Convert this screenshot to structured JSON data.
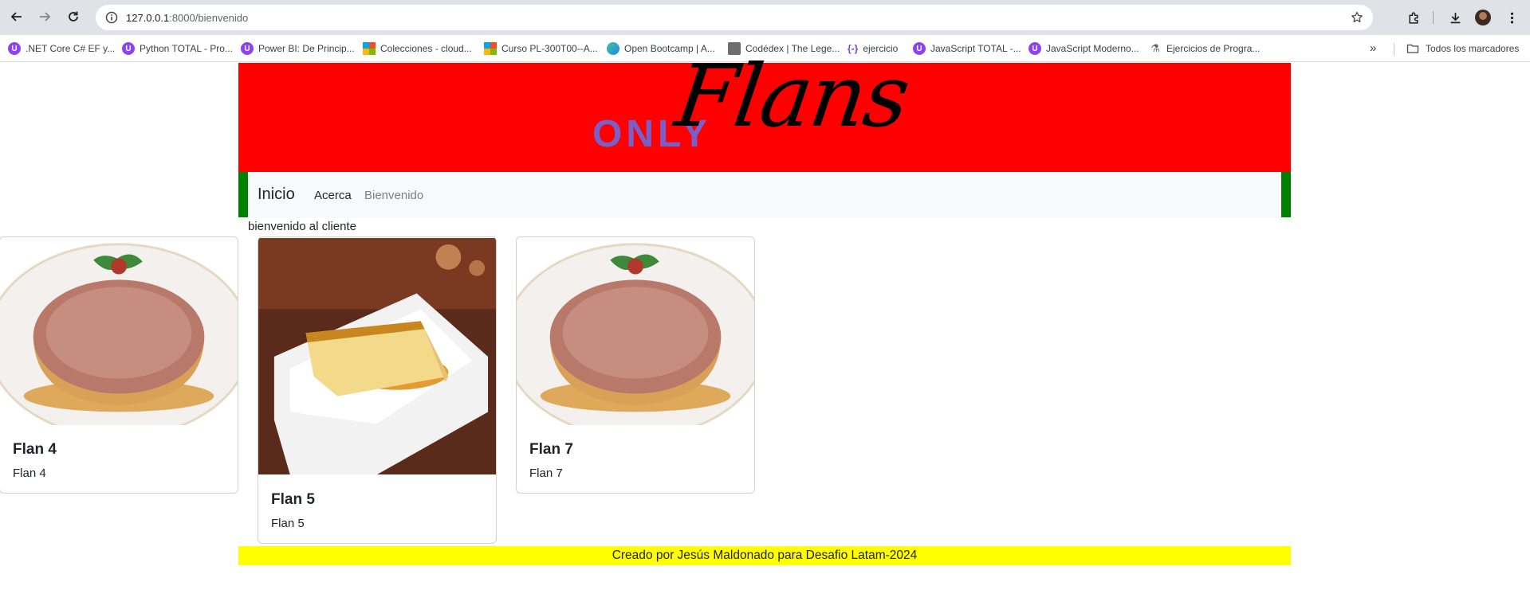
{
  "browser": {
    "url_host": "127.0.0.1",
    "url_path": ":8000/bienvenido",
    "icons": [
      "back-arrow-icon",
      "forward-arrow-icon",
      "reload-icon",
      "site-info-icon",
      "bookmark-star-icon",
      "extensions-icon",
      "download-icon",
      "profile-avatar",
      "more-menu-icon"
    ],
    "bookmarks": [
      {
        "label": ".NET Core C# EF y...",
        "icon": "udemy-icon"
      },
      {
        "label": "Python TOTAL - Pro...",
        "icon": "udemy-icon"
      },
      {
        "label": "Power BI: De Princip...",
        "icon": "udemy-icon"
      },
      {
        "label": "Colecciones - cloud...",
        "icon": "microsoft-icon"
      },
      {
        "label": "Curso PL-300T00--A...",
        "icon": "microsoft-icon"
      },
      {
        "label": "Open Bootcamp | A...",
        "icon": "openbootcamp-icon"
      },
      {
        "label": "Codédex | The Lege...",
        "icon": "codedex-icon"
      },
      {
        "label": "ejercicio",
        "icon": "braces-icon"
      },
      {
        "label": "JavaScript TOTAL -...",
        "icon": "udemy-icon"
      },
      {
        "label": "JavaScript Moderno...",
        "icon": "udemy-icon"
      },
      {
        "label": "Ejercicios de Progra...",
        "icon": "flask-icon"
      }
    ],
    "all_bookmarks_label": "Todos los marcadores"
  },
  "header": {
    "logo_only": "ONLY",
    "logo_flans": "Flans",
    "banner_color": "#ff0000",
    "border_color": "#008000"
  },
  "nav": {
    "brand": "Inicio",
    "links": [
      "Acerca",
      "Bienvenido"
    ]
  },
  "main": {
    "welcome_text": "bienvenido al cliente",
    "cards": [
      {
        "title": "Flan 4",
        "text": "Flan 4",
        "image": "flan-whole-plate"
      },
      {
        "title": "Flan 5",
        "text": "Flan 5",
        "image": "flan-slice-plate"
      },
      {
        "title": "Flan 7",
        "text": "Flan 7",
        "image": "flan-whole-plate"
      }
    ]
  },
  "footer": {
    "text": "Creado por Jesús Maldonado para Desafio Latam-2024",
    "color": "#ffff00"
  }
}
